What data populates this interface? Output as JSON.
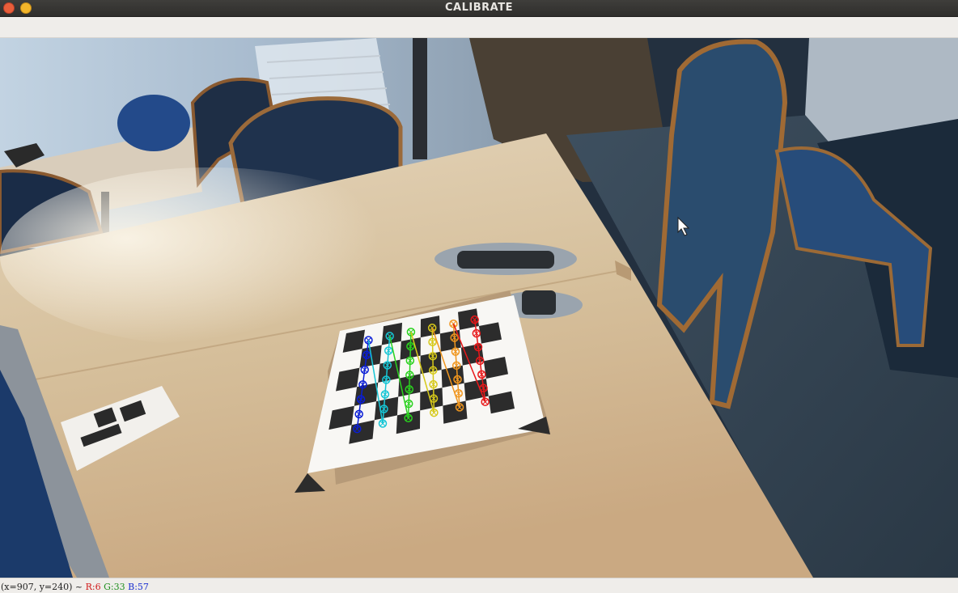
{
  "window": {
    "title": "CALIBRATE"
  },
  "statusbar": {
    "coords": "(x=907, y=240) ~",
    "r": "R:6",
    "g": "G:33",
    "b": "B:57"
  },
  "colors": {
    "titlebar": "#3c3b37",
    "close_button": "#e95e3a",
    "minimize_button": "#f2b52a",
    "panel": "#efedea",
    "status_r": "#d01a1a",
    "status_g": "#1f8f1f",
    "status_b": "#1a2fd0"
  },
  "icons": {
    "cursor": "mouse-pointer-icon"
  },
  "overlay": {
    "description": "detected chessboard corners drawn as colored circles joined by lines",
    "row_colors": [
      "#0a1ed6",
      "#17c6d6",
      "#2ad21e",
      "#d6c91a",
      "#f0961e",
      "#e8181a"
    ]
  }
}
